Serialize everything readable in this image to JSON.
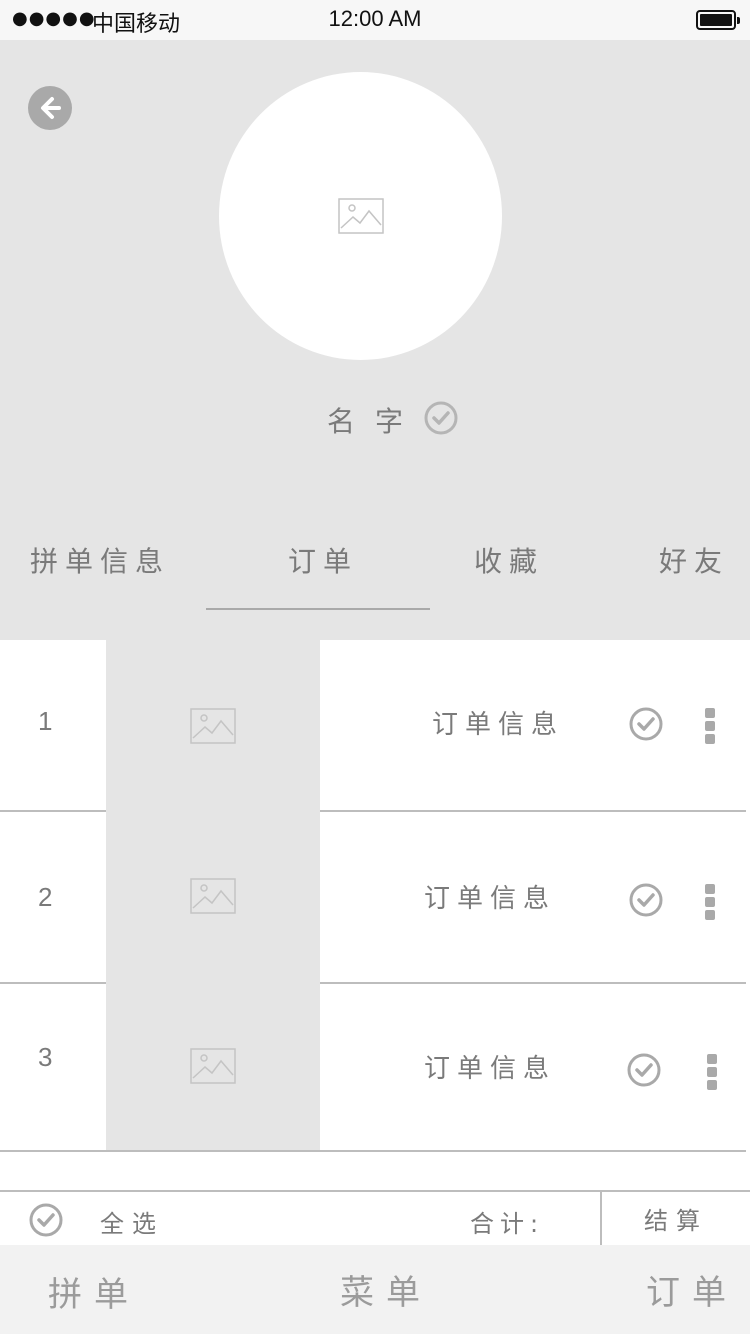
{
  "status_bar": {
    "signal": "●●●●●",
    "carrier": "中国移动",
    "time": "12:00 AM",
    "battery_icon": "battery-full-icon"
  },
  "profile": {
    "back_icon": "back-arrow-icon",
    "avatar_icon": "image-placeholder-icon",
    "name": "名字",
    "verified_icon": "check-circle-icon"
  },
  "tabs": [
    {
      "label": "拼单信息",
      "active": false
    },
    {
      "label": "订单",
      "active": true
    },
    {
      "label": "收藏",
      "active": false
    },
    {
      "label": "好友",
      "active": false
    }
  ],
  "orders": [
    {
      "index": "1",
      "info": "订单信息",
      "thumb_icon": "image-placeholder-icon",
      "check_icon": "check-circle-icon",
      "more_icon": "more-vertical-icon"
    },
    {
      "index": "2",
      "info": "订单信息",
      "thumb_icon": "image-placeholder-icon",
      "check_icon": "check-circle-icon",
      "more_icon": "more-vertical-icon"
    },
    {
      "index": "3",
      "info": "订单信息",
      "thumb_icon": "image-placeholder-icon",
      "check_icon": "check-circle-icon",
      "more_icon": "more-vertical-icon"
    }
  ],
  "checkout": {
    "select_all_label": "全选",
    "total_label": "合计:",
    "checkout_button": "结算"
  },
  "tab_bar": [
    {
      "label": "拼单"
    },
    {
      "label": "菜单"
    },
    {
      "label": "订单"
    }
  ],
  "colors": {
    "header_bg": "#e5e5e5",
    "icon_gray": "#a9a9a9",
    "text_gray": "#7a7a7a",
    "tab_bar_bg": "#f2f2f2"
  }
}
